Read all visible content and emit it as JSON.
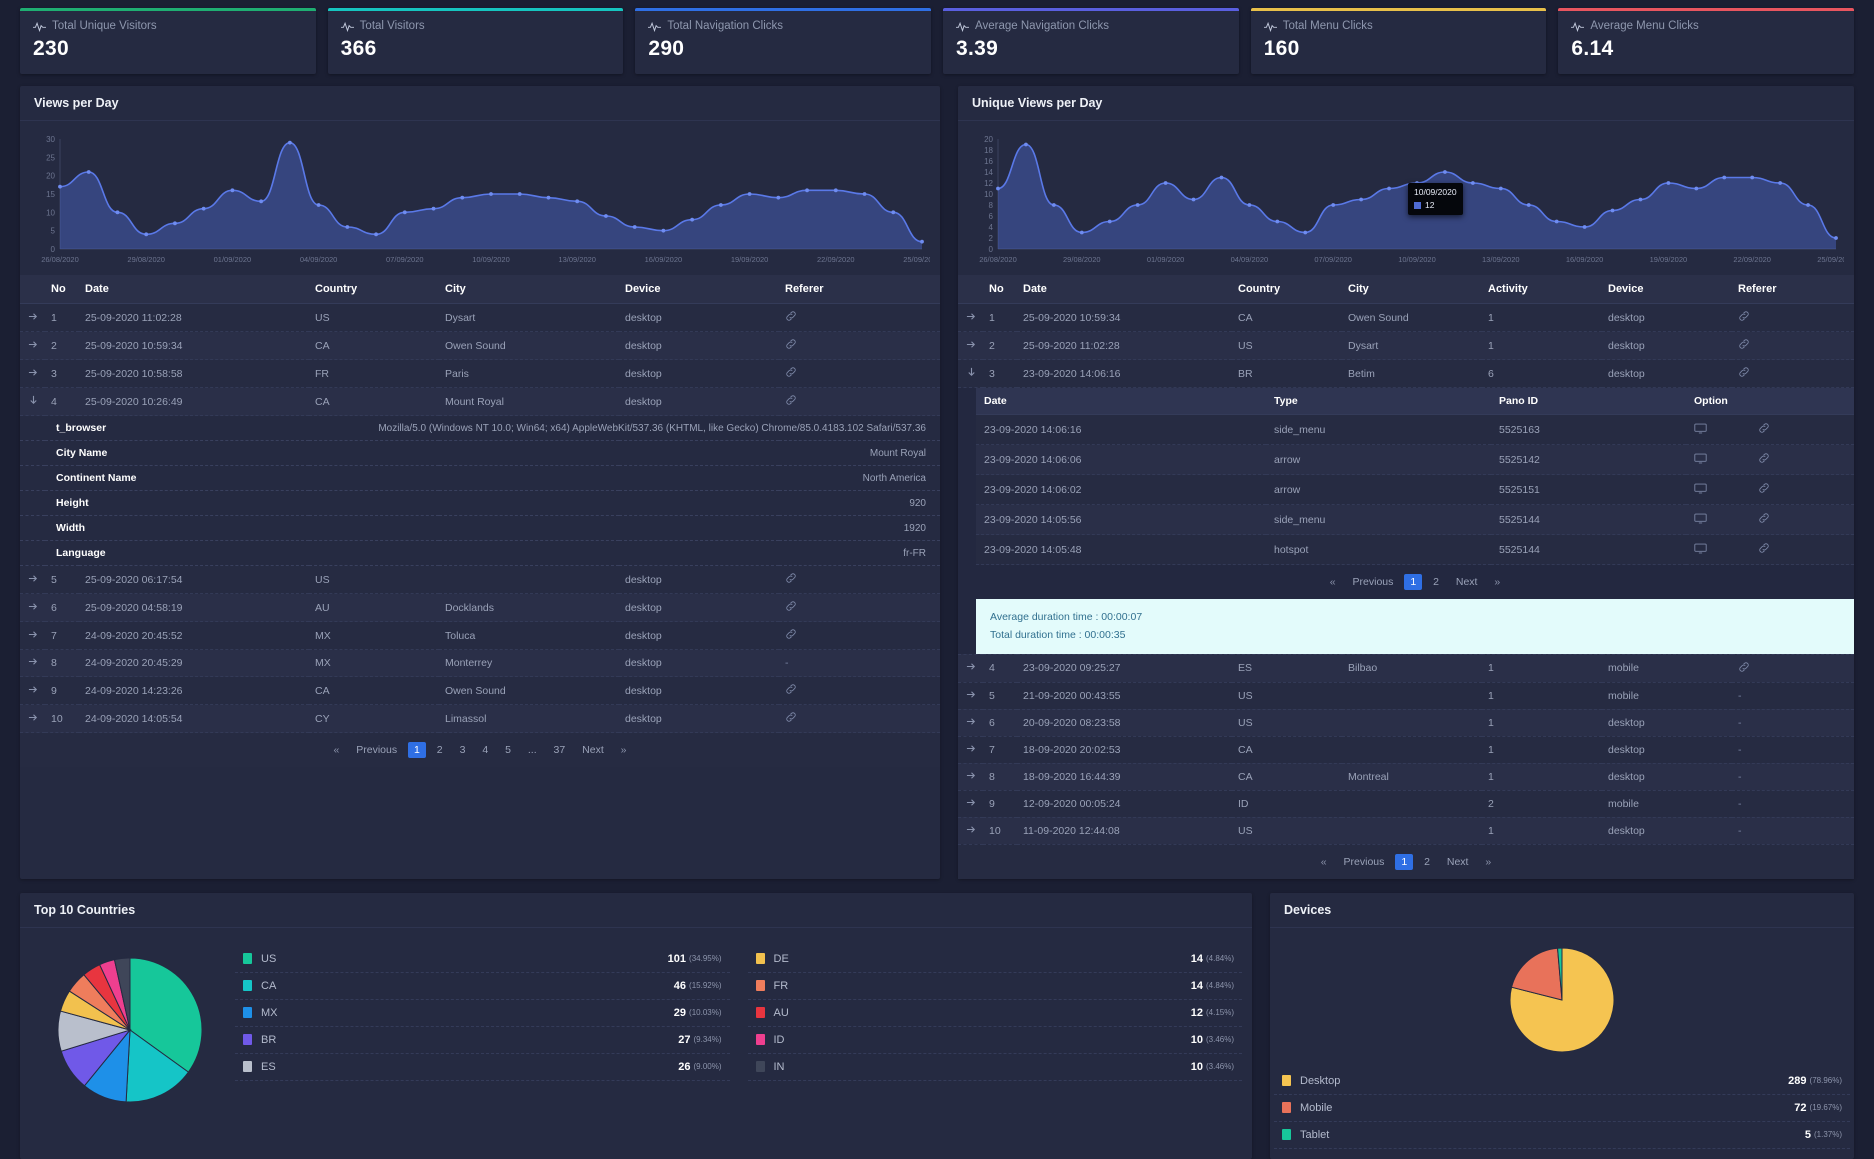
{
  "stats": [
    {
      "label": "Total Unique Visitors",
      "value": "230",
      "accent": "#1fae72",
      "icon": "pulse-icon"
    },
    {
      "label": "Total Visitors",
      "value": "366",
      "accent": "#16c5c0",
      "icon": "pulse-icon"
    },
    {
      "label": "Total Navigation Clicks",
      "value": "290",
      "accent": "#2f6fe4",
      "icon": "pulse-icon"
    },
    {
      "label": "Average Navigation Clicks",
      "value": "3.39",
      "accent": "#5a5fe0",
      "icon": "pulse-icon"
    },
    {
      "label": "Total Menu Clicks",
      "value": "160",
      "accent": "#e8c04a",
      "icon": "pulse-icon"
    },
    {
      "label": "Average Menu Clicks",
      "value": "6.14",
      "accent": "#e8555f",
      "icon": "pulse-icon"
    }
  ],
  "views_panel": {
    "title": "Views per Day"
  },
  "unique_panel": {
    "title": "Unique Views per Day"
  },
  "chart_data": [
    {
      "type": "area",
      "title": "Views per Day",
      "xlabel": "",
      "ylabel": "",
      "ylim": [
        0,
        30
      ],
      "yticks": [
        0,
        5,
        10,
        15,
        20,
        25,
        30
      ],
      "grid": false,
      "legend": "none",
      "series_color": "#4e6bd4",
      "x": [
        "26/08/2020",
        "27/08/2020",
        "28/08/2020",
        "29/08/2020",
        "30/08/2020",
        "31/08/2020",
        "01/09/2020",
        "02/09/2020",
        "03/09/2020",
        "04/09/2020",
        "05/09/2020",
        "06/09/2020",
        "07/09/2020",
        "08/09/2020",
        "09/09/2020",
        "10/09/2020",
        "11/09/2020",
        "12/09/2020",
        "13/09/2020",
        "14/09/2020",
        "15/09/2020",
        "16/09/2020",
        "17/09/2020",
        "18/09/2020",
        "19/09/2020",
        "20/09/2020",
        "21/09/2020",
        "22/09/2020",
        "23/09/2020",
        "24/09/2020",
        "25/09/2020"
      ],
      "xtick_labels": [
        "26/08/2020",
        "29/08/2020",
        "01/09/2020",
        "04/09/2020",
        "07/09/2020",
        "10/09/2020",
        "13/09/2020",
        "16/09/2020",
        "19/09/2020",
        "22/09/2020",
        "25/09/2020"
      ],
      "values": [
        17,
        21,
        10,
        4,
        7,
        11,
        16,
        13,
        29,
        12,
        6,
        4,
        10,
        11,
        14,
        15,
        15,
        14,
        13,
        9,
        6,
        5,
        8,
        12,
        15,
        14,
        16,
        16,
        15,
        10,
        2
      ]
    },
    {
      "type": "area",
      "title": "Unique Views per Day",
      "xlabel": "",
      "ylabel": "",
      "ylim": [
        0,
        20
      ],
      "yticks": [
        0,
        2,
        4,
        6,
        8,
        10,
        12,
        14,
        16,
        18,
        20
      ],
      "grid": false,
      "legend": "none",
      "series_color": "#4e6bd4",
      "x": [
        "26/08/2020",
        "27/08/2020",
        "28/08/2020",
        "29/08/2020",
        "30/08/2020",
        "31/08/2020",
        "01/09/2020",
        "02/09/2020",
        "03/09/2020",
        "04/09/2020",
        "05/09/2020",
        "06/09/2020",
        "07/09/2020",
        "08/09/2020",
        "09/09/2020",
        "10/09/2020",
        "11/09/2020",
        "12/09/2020",
        "13/09/2020",
        "14/09/2020",
        "15/09/2020",
        "16/09/2020",
        "17/09/2020",
        "18/09/2020",
        "19/09/2020",
        "20/09/2020",
        "21/09/2020",
        "22/09/2020",
        "23/09/2020",
        "24/09/2020",
        "25/09/2020"
      ],
      "xtick_labels": [
        "26/08/2020",
        "29/08/2020",
        "01/09/2020",
        "04/09/2020",
        "07/09/2020",
        "10/09/2020",
        "13/09/2020",
        "16/09/2020",
        "19/09/2020",
        "22/09/2020",
        "25/09/2020"
      ],
      "values": [
        11,
        19,
        8,
        3,
        5,
        8,
        12,
        9,
        13,
        8,
        5,
        3,
        8,
        9,
        11,
        12,
        14,
        12,
        11,
        8,
        5,
        4,
        7,
        9,
        12,
        11,
        13,
        13,
        12,
        8,
        2
      ],
      "tooltip": {
        "date": "10/09/2020",
        "value": "12",
        "series_color": "#4e6bd4"
      }
    },
    {
      "type": "pie",
      "title": "Top 10 Countries",
      "labels": [
        "US",
        "CA",
        "MX",
        "BR",
        "ES",
        "DE",
        "FR",
        "AU",
        "ID",
        "IN"
      ],
      "values": [
        101,
        46,
        29,
        27,
        26,
        14,
        14,
        12,
        10,
        10
      ],
      "percents": [
        "34.95%",
        "15.92%",
        "10.03%",
        "9.34%",
        "9.00%",
        "4.84%",
        "4.84%",
        "4.15%",
        "3.46%",
        "3.46%"
      ],
      "colors": [
        "#16c79a",
        "#15c5c7",
        "#1e90e8",
        "#7059e8",
        "#b9bfcc",
        "#f2c14e",
        "#ef7d5c",
        "#e8353f",
        "#ef3f8f",
        "#3f4659"
      ]
    },
    {
      "type": "pie",
      "title": "Devices",
      "labels": [
        "Desktop",
        "Mobile",
        "Tablet"
      ],
      "values": [
        289,
        72,
        5
      ],
      "percents": [
        "78.96%",
        "19.67%",
        "1.37%"
      ],
      "colors": [
        "#f5c451",
        "#e8725a",
        "#17c79a"
      ]
    }
  ],
  "views_table": {
    "columns": [
      "No",
      "Date",
      "Country",
      "City",
      "Device",
      "Referer"
    ],
    "rows": [
      {
        "no": "1",
        "date": "25-09-2020 11:02:28",
        "country": "US",
        "city": "Dysart",
        "device": "desktop",
        "referer": "link",
        "arrow": "right"
      },
      {
        "no": "2",
        "date": "25-09-2020 10:59:34",
        "country": "CA",
        "city": "Owen Sound",
        "device": "desktop",
        "referer": "link",
        "arrow": "right"
      },
      {
        "no": "3",
        "date": "25-09-2020 10:58:58",
        "country": "FR",
        "city": "Paris",
        "device": "desktop",
        "referer": "link",
        "arrow": "right"
      },
      {
        "no": "4",
        "date": "25-09-2020 10:26:49",
        "country": "CA",
        "city": "Mount Royal",
        "device": "desktop",
        "referer": "link",
        "arrow": "down"
      },
      {
        "no": "5",
        "date": "25-09-2020 06:17:54",
        "country": "US",
        "city": "",
        "device": "desktop",
        "referer": "link",
        "arrow": "right"
      },
      {
        "no": "6",
        "date": "25-09-2020 04:58:19",
        "country": "AU",
        "city": "Docklands",
        "device": "desktop",
        "referer": "link",
        "arrow": "right"
      },
      {
        "no": "7",
        "date": "24-09-2020 20:45:52",
        "country": "MX",
        "city": "Toluca",
        "device": "desktop",
        "referer": "link",
        "arrow": "right"
      },
      {
        "no": "8",
        "date": "24-09-2020 20:45:29",
        "country": "MX",
        "city": "Monterrey",
        "device": "desktop",
        "referer": "dash",
        "arrow": "right"
      },
      {
        "no": "9",
        "date": "24-09-2020 14:23:26",
        "country": "CA",
        "city": "Owen Sound",
        "device": "desktop",
        "referer": "link",
        "arrow": "right"
      },
      {
        "no": "10",
        "date": "24-09-2020 14:05:54",
        "country": "CY",
        "city": "Limassol",
        "device": "desktop",
        "referer": "link",
        "arrow": "right"
      }
    ],
    "detail": [
      {
        "key": "t_browser",
        "value": "Mozilla/5.0 (Windows NT 10.0; Win64; x64) AppleWebKit/537.36 (KHTML, like Gecko) Chrome/85.0.4183.102 Safari/537.36"
      },
      {
        "key": "City Name",
        "value": "Mount Royal"
      },
      {
        "key": "Continent Name",
        "value": "North America"
      },
      {
        "key": "Height",
        "value": "920"
      },
      {
        "key": "Width",
        "value": "1920"
      },
      {
        "key": "Language",
        "value": "fr-FR"
      }
    ],
    "pager": {
      "previous": "Previous",
      "next": "Next",
      "pages": [
        "1",
        "2",
        "3",
        "4",
        "5",
        "...",
        "37"
      ],
      "active": "1"
    }
  },
  "unique_table": {
    "columns": [
      "No",
      "Date",
      "Country",
      "City",
      "Activity",
      "Device",
      "Referer"
    ],
    "rows_top": [
      {
        "no": "1",
        "date": "25-09-2020 10:59:34",
        "country": "CA",
        "city": "Owen Sound",
        "activity": "1",
        "device": "desktop",
        "referer": "link",
        "arrow": "right"
      },
      {
        "no": "2",
        "date": "25-09-2020 11:02:28",
        "country": "US",
        "city": "Dysart",
        "activity": "1",
        "device": "desktop",
        "referer": "link",
        "arrow": "right"
      },
      {
        "no": "3",
        "date": "23-09-2020 14:06:16",
        "country": "BR",
        "city": "Betim",
        "activity": "6",
        "device": "desktop",
        "referer": "link",
        "arrow": "down"
      }
    ],
    "rows_bottom": [
      {
        "no": "4",
        "date": "23-09-2020 09:25:27",
        "country": "ES",
        "city": "Bilbao",
        "activity": "1",
        "device": "mobile",
        "referer": "link",
        "arrow": "right"
      },
      {
        "no": "5",
        "date": "21-09-2020 00:43:55",
        "country": "US",
        "city": "",
        "activity": "1",
        "device": "mobile",
        "referer": "dash",
        "arrow": "right"
      },
      {
        "no": "6",
        "date": "20-09-2020 08:23:58",
        "country": "US",
        "city": "",
        "activity": "1",
        "device": "desktop",
        "referer": "dash",
        "arrow": "right"
      },
      {
        "no": "7",
        "date": "18-09-2020 20:02:53",
        "country": "CA",
        "city": "",
        "activity": "1",
        "device": "desktop",
        "referer": "dash",
        "arrow": "right"
      },
      {
        "no": "8",
        "date": "18-09-2020 16:44:39",
        "country": "CA",
        "city": "Montreal",
        "activity": "1",
        "device": "desktop",
        "referer": "dash",
        "arrow": "right"
      },
      {
        "no": "9",
        "date": "12-09-2020 00:05:24",
        "country": "ID",
        "city": "",
        "activity": "2",
        "device": "mobile",
        "referer": "dash",
        "arrow": "right"
      },
      {
        "no": "10",
        "date": "11-09-2020 12:44:08",
        "country": "US",
        "city": "",
        "activity": "1",
        "device": "desktop",
        "referer": "dash",
        "arrow": "right"
      }
    ],
    "sub": {
      "columns": [
        "Date",
        "Type",
        "Pano ID",
        "Option"
      ],
      "rows": [
        {
          "date": "23-09-2020 14:06:16",
          "type": "side_menu",
          "pano": "5525163"
        },
        {
          "date": "23-09-2020 14:06:06",
          "type": "arrow",
          "pano": "5525142"
        },
        {
          "date": "23-09-2020 14:06:02",
          "type": "arrow",
          "pano": "5525151"
        },
        {
          "date": "23-09-2020 14:05:56",
          "type": "side_menu",
          "pano": "5525144"
        },
        {
          "date": "23-09-2020 14:05:48",
          "type": "hotspot",
          "pano": "5525144"
        }
      ],
      "pager": {
        "previous": "Previous",
        "next": "Next",
        "pages": [
          "1",
          "2"
        ],
        "active": "1"
      },
      "info": {
        "average": "Average duration time : 00:00:07",
        "total": "Total duration time : 00:00:35"
      }
    },
    "pager": {
      "previous": "Previous",
      "next": "Next",
      "pages": [
        "1",
        "2"
      ],
      "active": "1"
    }
  },
  "countries_panel": {
    "title": "Top 10 Countries"
  },
  "devices_panel": {
    "title": "Devices"
  }
}
